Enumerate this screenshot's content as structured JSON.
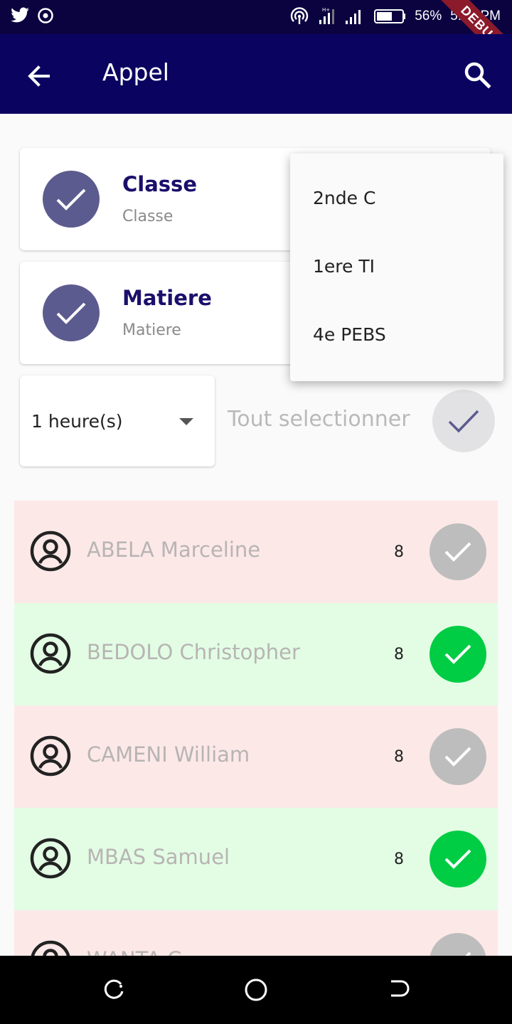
{
  "status_bar": {
    "battery": "56%",
    "time": "5:32 PM",
    "debug_label": "DEBUG",
    "icons": [
      "twitter-icon",
      "media-icon",
      "hotspot-icon",
      "data-signal-icon",
      "signal-bars-icon",
      "battery-icon"
    ]
  },
  "app_bar": {
    "title": "Appel",
    "back_icon": "arrow-back-icon",
    "search_icon": "search-icon"
  },
  "classe_card": {
    "title": "Classe",
    "subtitle": "Classe"
  },
  "matiere_card": {
    "title": "Matiere",
    "subtitle": "Matiere"
  },
  "hours_select": {
    "value": "1 heure(s)"
  },
  "select_all": {
    "label": "Tout selectionner"
  },
  "students": [
    {
      "name": "ABELA Marceline",
      "count": "8",
      "present": false
    },
    {
      "name": "BEDOLO Christopher",
      "count": "8",
      "present": true
    },
    {
      "name": "CAMENI William",
      "count": "8",
      "present": false
    },
    {
      "name": "MBAS Samuel",
      "count": "8",
      "present": true
    },
    {
      "name": "WANTA C",
      "count": "",
      "present": false
    }
  ],
  "class_menu": {
    "items": [
      "2nde C",
      "1ere TI",
      "4e PEBS"
    ]
  },
  "colors": {
    "app_bar": "#0b0360",
    "accent": "#5c5b8f",
    "present": "#00cc44",
    "absent_bg": "#fde8e8",
    "present_bg": "#e2fde4"
  }
}
